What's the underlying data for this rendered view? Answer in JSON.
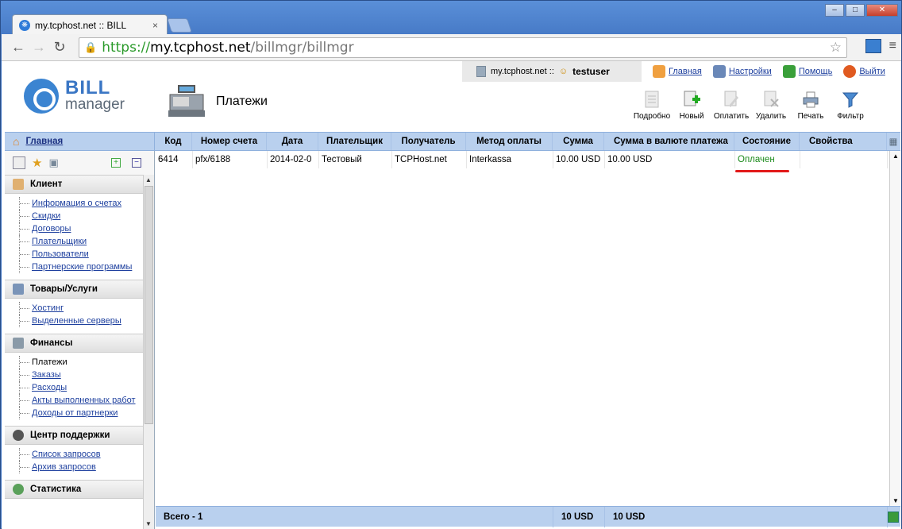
{
  "browser": {
    "tab_title": "my.tcphost.net :: BILL",
    "tab_close": "×",
    "url_scheme": "https://",
    "url_host": "my.tcphost.net",
    "url_path": "/billmgr/billmgr",
    "win_min": "–",
    "win_max": "□",
    "win_close": "✕"
  },
  "userbar": {
    "site": "my.tcphost.net ::",
    "username": "testuser",
    "links": [
      "Главная",
      "Настройки",
      "Помощь",
      "Выйти"
    ]
  },
  "logo": {
    "line1": "BILL",
    "line2": "manager"
  },
  "page_title": "Платежи",
  "actions": [
    "Подробно",
    "Новый",
    "Оплатить",
    "Удалить",
    "Печать",
    "Фильтр"
  ],
  "header": {
    "home": "Главная",
    "columns": [
      "Код",
      "Номер счета",
      "Дата",
      "Плательщик",
      "Получатель",
      "Метод оплаты",
      "Сумма",
      "Сумма в валюте платежа",
      "Состояние",
      "Свойства"
    ]
  },
  "rows": [
    [
      "6414",
      "pfx/6188",
      "2014-02-0",
      "Тестовый",
      "TCPHost.net",
      "Interkassa",
      "10.00 USD",
      "10.00 USD",
      "Оплачен",
      ""
    ]
  ],
  "sidebar": {
    "groups": [
      {
        "title": "Клиент",
        "items": [
          "Информация о счетах",
          "Скидки",
          "Договоры",
          "Плательщики",
          "Пользователи",
          "Партнерские программы"
        ]
      },
      {
        "title": "Товары/Услуги",
        "items": [
          "Хостинг",
          "Выделенные серверы"
        ]
      },
      {
        "title": "Финансы",
        "items": [
          "Платежи",
          "Заказы",
          "Расходы",
          "Акты выполненных работ",
          "Доходы от партнерки"
        ]
      },
      {
        "title": "Центр поддержки",
        "items": [
          "Список запросов",
          "Архив запросов"
        ]
      },
      {
        "title": "Статистика",
        "items": []
      }
    ],
    "current_item": "Платежи"
  },
  "footer": {
    "total": "Всего - 1",
    "sum": "10 USD",
    "sum_currency": "10 USD"
  },
  "colors": {
    "accent": "#b9d0ee",
    "status_ok": "#1a8a1a",
    "underline": "#e21a1a"
  }
}
